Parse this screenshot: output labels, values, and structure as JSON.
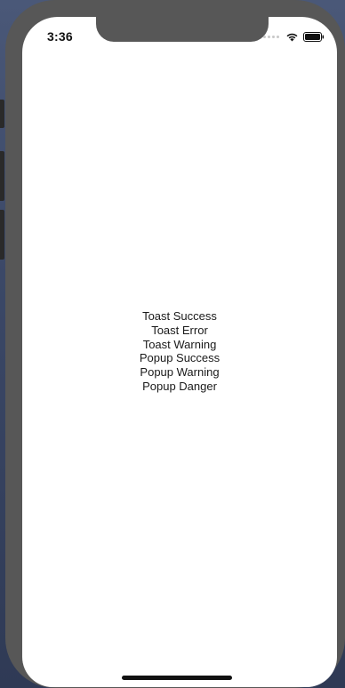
{
  "status_bar": {
    "time": "3:36",
    "wifi_icon": "wifi-icon",
    "battery_icon": "battery-icon"
  },
  "menu": {
    "items": [
      "Toast Success",
      "Toast Error",
      "Toast Warning",
      "Popup Success",
      "Popup Warning",
      "Popup Danger"
    ]
  },
  "colors": {
    "device_frame": "#575757",
    "screen_bg": "#ffffff",
    "text": "#1a1a1a"
  }
}
